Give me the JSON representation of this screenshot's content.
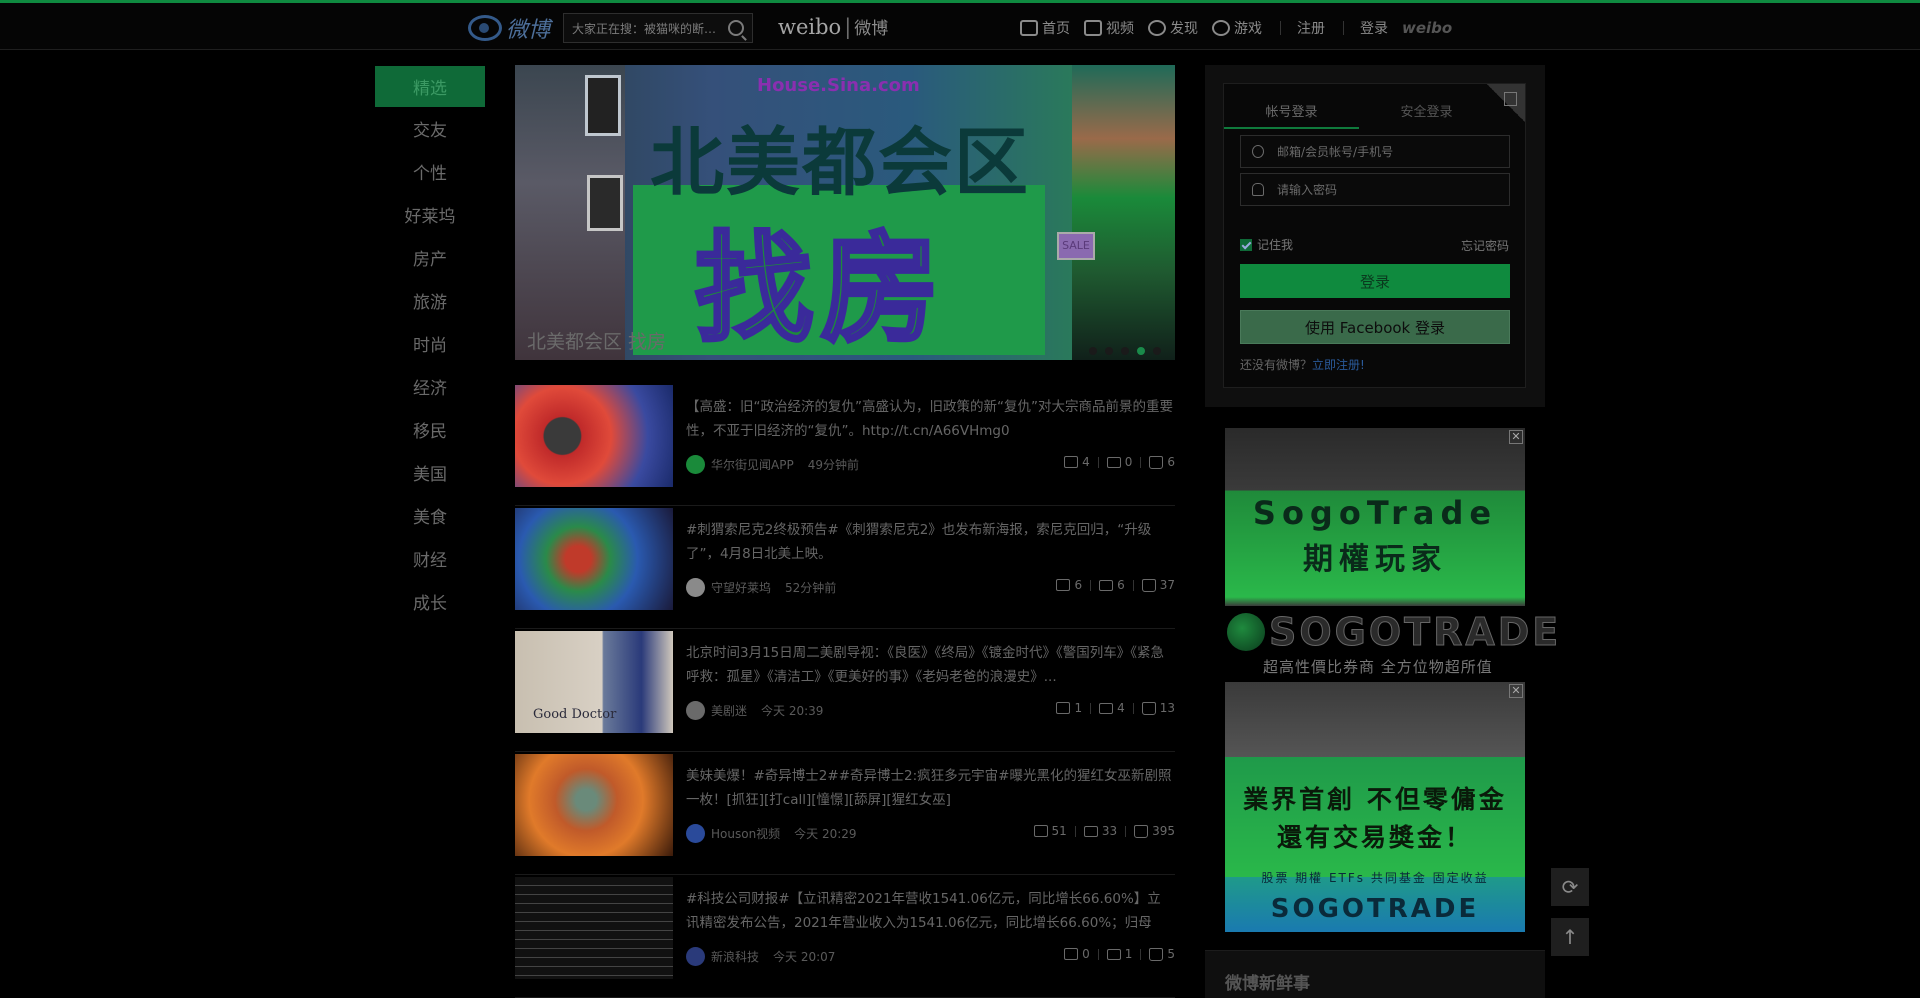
{
  "header": {
    "logo_text": "微博",
    "search_placeholder": "大家正在搜：被猫咪的断…",
    "brand_main": "weibo",
    "brand_sep": "|",
    "brand_cn": "微博",
    "nav": [
      {
        "label": "首页",
        "icon": "home-icon"
      },
      {
        "label": "视频",
        "icon": "video-icon"
      },
      {
        "label": "发现",
        "icon": "discover-icon"
      },
      {
        "label": "游戏",
        "icon": "game-icon"
      }
    ],
    "register": "注册",
    "login": "登录",
    "weibo_mark": "weibo"
  },
  "sidebar": {
    "items": [
      {
        "label": "精选"
      },
      {
        "label": "交友"
      },
      {
        "label": "个性"
      },
      {
        "label": "好莱坞"
      },
      {
        "label": "房产"
      },
      {
        "label": "旅游"
      },
      {
        "label": "时尚"
      },
      {
        "label": "经济"
      },
      {
        "label": "移民"
      },
      {
        "label": "美国"
      },
      {
        "label": "美食"
      },
      {
        "label": "财经"
      },
      {
        "label": "成长"
      }
    ],
    "active_index": 0
  },
  "banner": {
    "url": "House.Sina.com",
    "headline": "北美都会区",
    "subheadline": "找房",
    "caption": "北美都会区 找房",
    "sign": "SALE",
    "dots_total": 5,
    "active_dot": 3
  },
  "feed": [
    {
      "text": "【高盛：旧“政治经济的复仇”高盛认为，旧政策的新“复仇”对大宗商品前景的重要性，不亚于旧经济的“复仇”。http://t.cn/A66VHmg0",
      "source": "华尔街见闻APP",
      "time": "49分钟前",
      "shares": "4",
      "comments": "0",
      "likes": "6"
    },
    {
      "text": "#刺猬索尼克2终极预告#《刺猬索尼克2》也发布新海报，索尼克回归，“升级了”，4月8日北美上映。",
      "source": "守望好莱坞",
      "time": "52分钟前",
      "shares": "6",
      "comments": "6",
      "likes": "37"
    },
    {
      "text": "北京时间3月15日周二美剧导视：《良医》《终局》《镀金时代》《警国列车》《紧急呼救：孤星》《清洁工》《更美好的事》《老妈老爸的浪漫史》...",
      "source": "美剧迷",
      "time": "今天 20:39",
      "shares": "1",
      "comments": "4",
      "likes": "13",
      "thumb_label": "Good Doctor"
    },
    {
      "text": "美妹美爆！#奇异博士2##奇异博士2:疯狂多元宇宙#曝光黑化的猩红女巫新剧照一枚！[抓狂][打call][憧憬][舔屏][猩红女巫]",
      "source": "Houson视频",
      "time": "今天 20:29",
      "shares": "51",
      "comments": "33",
      "likes": "395"
    },
    {
      "text": "#科技公司财报#【立讯精密2021年营收1541.06亿元，同比增长66.60%】立讯精密发布公告，2021年营业收入为1541.06亿元，同比增长66.60%；归母净...",
      "source": "新浪科技",
      "time": "今天 20:07",
      "shares": "0",
      "comments": "1",
      "likes": "5"
    }
  ],
  "login": {
    "tab_account": "帐号登录",
    "tab_secure": "安全登录",
    "user_placeholder": "邮箱/会员帐号/手机号",
    "pass_placeholder": "请输入密码",
    "remember": "记住我",
    "forgot": "忘记密码",
    "login_button": "登录",
    "facebook_button": "使用 Facebook 登录",
    "no_account": "还没有微博？",
    "register_link": "立即注册!"
  },
  "ads": {
    "ad1_line1": "SogoTrade",
    "ad1_line2": "期權玩家",
    "ad2_brand": "SOGOTRADE",
    "ad2_tagline": "超高性價比券商 全方位物超所值",
    "ad3_line1": "業界首創 不但零傭金",
    "ad3_line2": "還有交易獎金！",
    "ad3_line3": "股票 期權 ETFs 共同基金 固定收益",
    "ad3_brand": "SOGOTRADE",
    "close_label": "✕"
  },
  "fresh": {
    "title": "微博新鲜事"
  },
  "float": {
    "refresh": "⟳",
    "top": "↑"
  },
  "colors": {
    "accent": "#0f8a40",
    "background": "#000000"
  }
}
